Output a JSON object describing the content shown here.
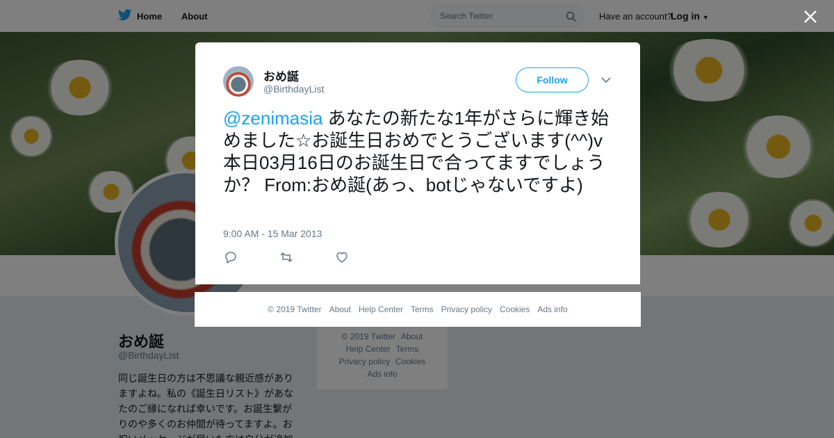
{
  "topbar": {
    "home_label": "Home",
    "about_label": "About",
    "search_placeholder": "Search Twitter",
    "have_account": "Have an account?",
    "login_label": "Log in"
  },
  "profile": {
    "name": "おめ誕",
    "handle": "@BirthdayList",
    "bio": "同じ誕生日の方は不思議な親近感がありますよね。私の《誕生日リスト》があなたのご縁になれば幸いです。お誕生繋がりのや多くのお仲間が待ってますよ。お祝いメッセージが届いた方は自分が追加"
  },
  "side_footer": {
    "copyright": "© 2019 Twitter",
    "about": "About",
    "help": "Help Center",
    "terms": "Terms",
    "privacy": "Privacy policy",
    "cookies": "Cookies",
    "ads": "Ads info"
  },
  "tweet": {
    "author_name": "おめ誕",
    "author_handle": "@BirthdayList",
    "follow_label": "Follow",
    "mention": "@zenimasia",
    "text": " あなたの新たな1年がさらに輝き始めました☆お誕生日おめでとうございます(^^)v 本日03月16日のお誕生日で合ってますでしょうか？ From:おめ誕(あっ、botじゃないですよ)",
    "timestamp": "9:00 AM - 15 Mar 2013"
  },
  "modal_footer": {
    "copyright": "© 2019 Twitter",
    "about": "About",
    "help": "Help Center",
    "terms": "Terms",
    "privacy": "Privacy policy",
    "cookies": "Cookies",
    "ads": "Ads info"
  },
  "colors": {
    "accent": "#1da1f2",
    "secondary_text": "#657786",
    "overlay": "rgba(0,0,0,0.5)"
  }
}
